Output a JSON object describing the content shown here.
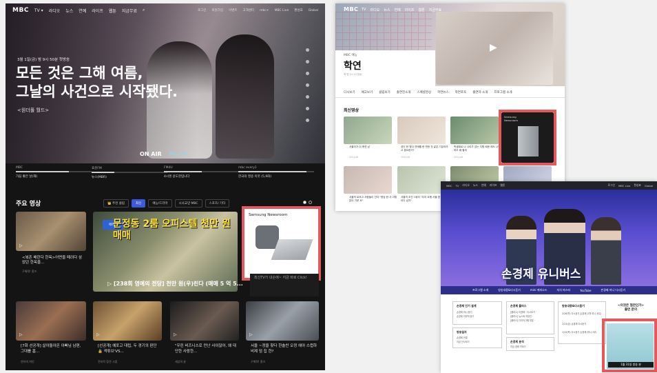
{
  "panel_a": {
    "nav": {
      "logo": "MBC",
      "items": [
        "TV ▾",
        "라디오",
        "뉴스",
        "연예",
        "라이프",
        "웹툰",
        "지금무료"
      ],
      "right_items": [
        "로그인",
        "회원가입",
        "이벤트",
        "고객센터",
        "mbc+",
        "MBC Live",
        "편성표",
        "Global"
      ]
    },
    "hero": {
      "date": "3월 1일(금) 밤 9시 50분 첫방송",
      "title_line1": "모든 것은 그해 여름,",
      "title_line2": "그날의 사건으로 시작됐다.",
      "link": "<원더풀 월드>",
      "on_air": "ON AIR",
      "live": "Mbc Live"
    },
    "channels": [
      {
        "label": "MBC",
        "value": "가끔 좋은 날(재)",
        "progress": 0.7
      },
      {
        "label": "표준FM",
        "value": "뉴스(MBR)",
        "progress": 0.3
      },
      {
        "label": "FM4U",
        "value": "4시엔 윤도현입니다",
        "progress": 0.5
      },
      {
        "label": "mbc every1",
        "value": "한국의 영웅 이웃 (5,9화)",
        "progress": 0.9
      }
    ],
    "main_videos": {
      "title": "주요 영상",
      "tabs": [
        "👑 추천 클립",
        "최신",
        "예능/드라마",
        "시사교양 MBC",
        "스포츠/ 기타",
        "구독하고 보기"
      ],
      "active_tab": 1
    },
    "row1": [
      {
        "caption": "<복존 배런다 한옥>어떤을 떼려다 삼았던 한옥을...",
        "meta": "구해줘! 홈즈"
      },
      {
        "badge": "에어랩",
        "feature": "문정동 2룸 오피스텔 천만 원 매매",
        "caption": "[238회 영예의 전당] 천만 원(우)린다 (매매 5 억 5..."
      },
      {
        "ad_brand": "Samsung Newsroom",
        "ad_text": "최신TV가 내손에~ 지금 바로 Click!"
      }
    ],
    "row2": [
      {
        "caption": "[7화 선공개] 살아돌아온 아빠님 남편, 그대를 홈...",
        "meta": "연하의 여인"
      },
      {
        "caption": "[선공개] 예포고 대립, 두 경기의 판단 🔒 곽튜브'VS...",
        "meta": "전지적 참견 시점"
      },
      {
        "caption": "\"우린 비즈니스로 만난 사이잖아, 왜 대단한 사람한...",
        "meta": "세상의 끝"
      },
      {
        "caption": "서울 ~정을 찾다 한솔찬 오정 헤아 스럽하 비제 덤 집 한?",
        "meta": "구해줘! 홈즈"
      }
    ]
  },
  "panel_b": {
    "nav": {
      "logo": "MBC",
      "items": [
        "TV",
        "라디오",
        "뉴스",
        "연예",
        "라이프",
        "웹툰",
        "지금무료"
      ]
    },
    "subtitle": "MBC 예능",
    "title": "학연",
    "meta": "목 밤 11:10 방송",
    "subnav": [
      "다시보기",
      "예고보기",
      "클립보기",
      "출연진소개",
      "스페셜영상",
      "학연뉴스",
      "학연포토",
      "출연자 소개",
      "프로그램 소개"
    ],
    "latest": "최신영상",
    "videos": [
      {
        "caption": "서울이가 이 총연 남",
        "date": "2024.06"
      },
      {
        "caption": "성인 한 명이 연애를 한 반한 것 같은 기분이라고 중요한가?",
        "date": "2024.06"
      },
      {
        "caption": "학생회로 나 나이가 있는 지원 때문 에도 나인 마오 때 할게",
        "date": "2024.06"
      },
      {
        "ad_brand": "Samsung Newsroom"
      },
      {
        "caption": "서울의 로또고 사례 표현 하기",
        "date": "2024.06"
      },
      {
        "caption": "서울의 로또고 사람들이 친다 \"명엄 한 사 이렇 분이 기운 요\"",
        "date": "2024.06"
      },
      {
        "caption": "서울의 조진 1위의 \"우리 요행 서울 한 생은 동이다 남자\"",
        "date": "2024.06"
      },
      {
        "caption": "흥겨운 사람의 뭐가?",
        "date": "2024.06"
      },
      {
        "caption": "서울의 자기 어려운 가 때 물질이 나와?? 연 사진 인 가족인",
        "date": "2024.06"
      }
    ]
  },
  "panel_c": {
    "topbar": [
      "MBC",
      "TV",
      "라디오",
      "뉴스",
      "연예",
      "라이프",
      "웹툰",
      "로그인",
      "MBC Live",
      "편성표",
      "Global"
    ],
    "title": "손경제 유니버스",
    "menu": [
      "프로그램 소개",
      "방송내용&다시듣기",
      "mini 에피소드",
      "지식 마스터",
      "YouTube",
      "손경제 미니 다시듣기"
    ],
    "boxes": [
      {
        "title": "손경제 인기 설계",
        "items": [
          "손경제 미니 듣기",
          "손경제 이렇게 듣기"
        ]
      },
      {
        "title": "손경제 플러스",
        "items": [
          "[플러스] 이현태 · 다시보기 ·",
          "[플러스] 뉴스와 직장인 ·",
          "[플러스] 다이어그램 부분 ·"
        ]
      },
      {
        "title": "방송내용&다시듣기",
        "items": [
          "2/26(월) 다시듣기 손경제 (2월 미니 공유)",
          "2/23(금) 손경제 다시듣기",
          "2/22(목) 다시듣기 손경제 (미니 2부)"
        ]
      },
      {
        "title": "방송일자",
        "items": [
          "손경제 연결",
          "지금 인사보기"
        ]
      },
      {
        "title": "손경제 분석",
        "items": [
          "지금 경제 이야기"
        ]
      }
    ],
    "promo": {
      "title": "<이것은 협찬인가>",
      "subtitle": "출연 문의",
      "caption": "1월 31일 방송 분"
    }
  }
}
